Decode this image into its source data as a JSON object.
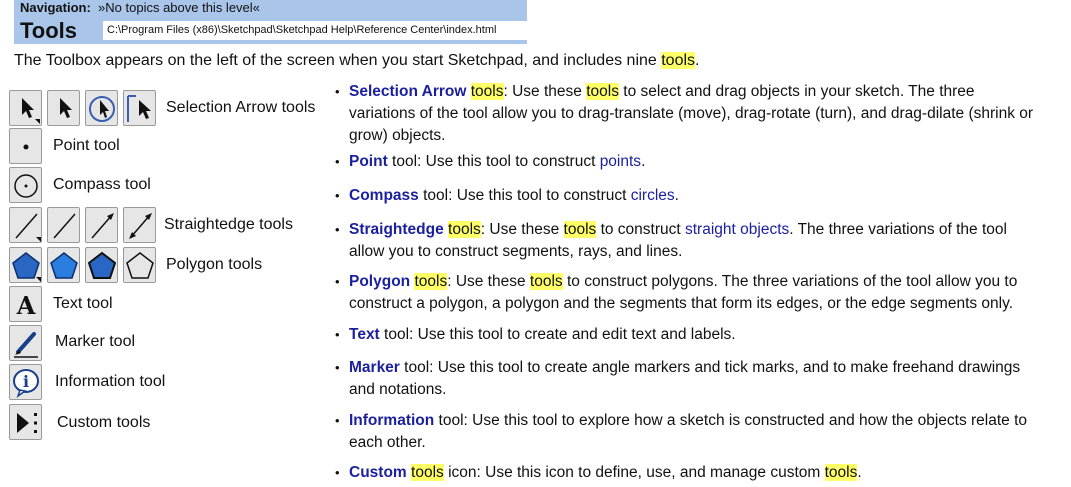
{
  "header": {
    "nav_label": "Navigation:",
    "nav_text": "»No topics above this level«",
    "title": "Tools",
    "path": "C:\\Program Files (x86)\\Sketchpad\\Sketchpad Help\\Reference Center\\index.html"
  },
  "intro": {
    "before": "The Toolbox appears on the left of the screen when you start Sketchpad, and includes nine ",
    "highlight": "tools",
    "after": "."
  },
  "toolbox": {
    "labels": [
      "Selection Arrow tools",
      "Point tool",
      "Compass tool",
      "Straightedge tools",
      "Polygon tools",
      "Text tool",
      "Marker tool",
      "Information tool",
      "Custom tools"
    ]
  },
  "items": [
    {
      "name": "Selection Arrow",
      "t1": " ",
      "h1": "tools",
      "t2": ": Use these ",
      "h2": "tools",
      "t3": " to select and drag objects in your sketch. The three",
      "line2": "variations of the tool allow you to drag-translate (move), drag-rotate (turn), and drag-dilate (shrink or",
      "line3": "grow) objects."
    },
    {
      "name": "Point",
      "t1": " tool: Use this tool to construct ",
      "link": "points",
      "t2": "."
    },
    {
      "name": "Compass",
      "t1": " tool: Use this tool to construct ",
      "link": "circles",
      "t2": "."
    },
    {
      "name": "Straightedge",
      "t1": " ",
      "h1": "tools",
      "t2": ": Use these ",
      "h2": "tools",
      "t3": " to construct ",
      "link": "straight objects",
      "t4": ". The three variations of the tool",
      "line2": "allow you to construct segments, rays, and lines."
    },
    {
      "name": "Polygon",
      "t1": " ",
      "h1": "tools",
      "t2": ": Use these ",
      "h2": "tools",
      "t3": " to construct polygons. The three variations of the tool allow you to",
      "line2": "construct a polygon, a polygon and the segments that form its edges, or the edge segments only."
    },
    {
      "name": "Text",
      "t1": " tool: Use this tool to create and edit text and labels."
    },
    {
      "name": "Marker",
      "t1": " tool: Use this tool to create angle markers and tick marks, and to make freehand drawings",
      "line2": "and notations."
    },
    {
      "name": "Information",
      "t1": " tool: Use this tool to explore how a sketch is constructed and how the objects relate to",
      "line2": "each other."
    },
    {
      "name": "Custom",
      "t1": " ",
      "h1": "tools",
      "t2": " icon: Use this icon to define, use, and manage custom ",
      "h2": "tools",
      "t3": "."
    }
  ],
  "bullet_char": "•"
}
